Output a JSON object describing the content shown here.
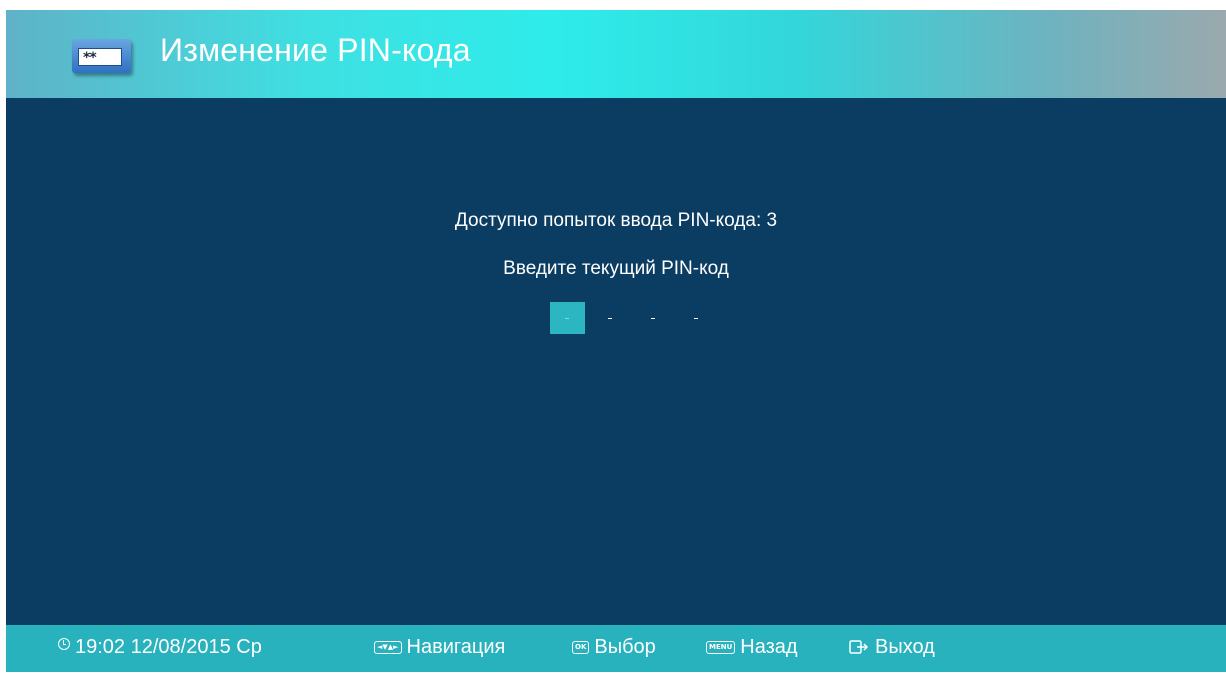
{
  "header": {
    "title": "Изменение PIN-кода",
    "icon": "pin-field-icon",
    "icon_text": "**"
  },
  "main": {
    "attempts_text": "Доступно попыток ввода PIN-кода: 3",
    "prompt_text": "Введите текущий PIN-код",
    "pin_placeholders": [
      "-",
      "-",
      "-",
      "-"
    ],
    "active_index": 0
  },
  "footer": {
    "clock": "19:02 12/08/2015 Ср",
    "navigation_label": "Навигация",
    "navigation_key": "◄▼▲►",
    "select_label": "Выбор",
    "select_key": "OK",
    "back_label": "Назад",
    "back_key": "MENU",
    "exit_label": "Выход"
  },
  "colors": {
    "background": "#0b3d63",
    "accent": "#27b2bd",
    "active_cell": "#2cb6c1"
  }
}
